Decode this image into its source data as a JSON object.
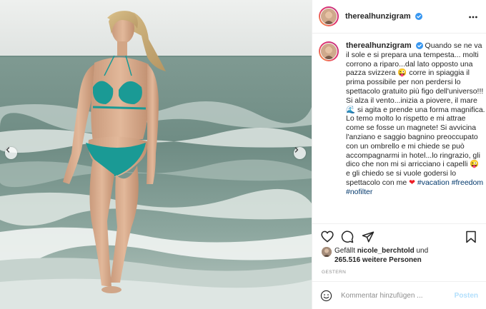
{
  "header": {
    "username": "therealhunzigram",
    "verified_color": "#3897f0",
    "more_icon": "more-options-icon"
  },
  "caption": {
    "username": "therealhunzigram",
    "text": "Quando se ne va il sole e si prepara una tempesta... molti corrono a riparo...dal lato opposto una pazza svizzera 😜 corre in spiaggia il prima possibile per non perdersi lo spettacolo gratuito più figo dell'universo!!! Si alza il vento...inizia a piovere, il mare 🌊 si agita e prende una forma magnifica. Lo temo molto lo rispetto e mi attrae come se fosse un magnete! Si avvicina l'anziano e saggio bagnino preoccupato con un ombrello e mi chiede se può accompagnarmi in hotel...lo ringrazio, gli dico che non mi si arricciano i capelli 😜 e gli chiedo se si vuole godersi lo spettacolo con me",
    "heart": "❤",
    "hashtags": "#vacation #freedom #nofilter"
  },
  "likes": {
    "prefix": "Gefällt",
    "user": "nicole_berchtold",
    "conjunction": "und",
    "count_text": "265.516 weitere Personen"
  },
  "timestamp": "GESTERN",
  "comment": {
    "placeholder": "Kommentar hinzufügen ...",
    "post_label": "Posten"
  },
  "colors": {
    "link": "#00376b",
    "muted": "#8e8e8e",
    "post_disabled": "#b2dffc",
    "bikini": "#1a9a95"
  }
}
